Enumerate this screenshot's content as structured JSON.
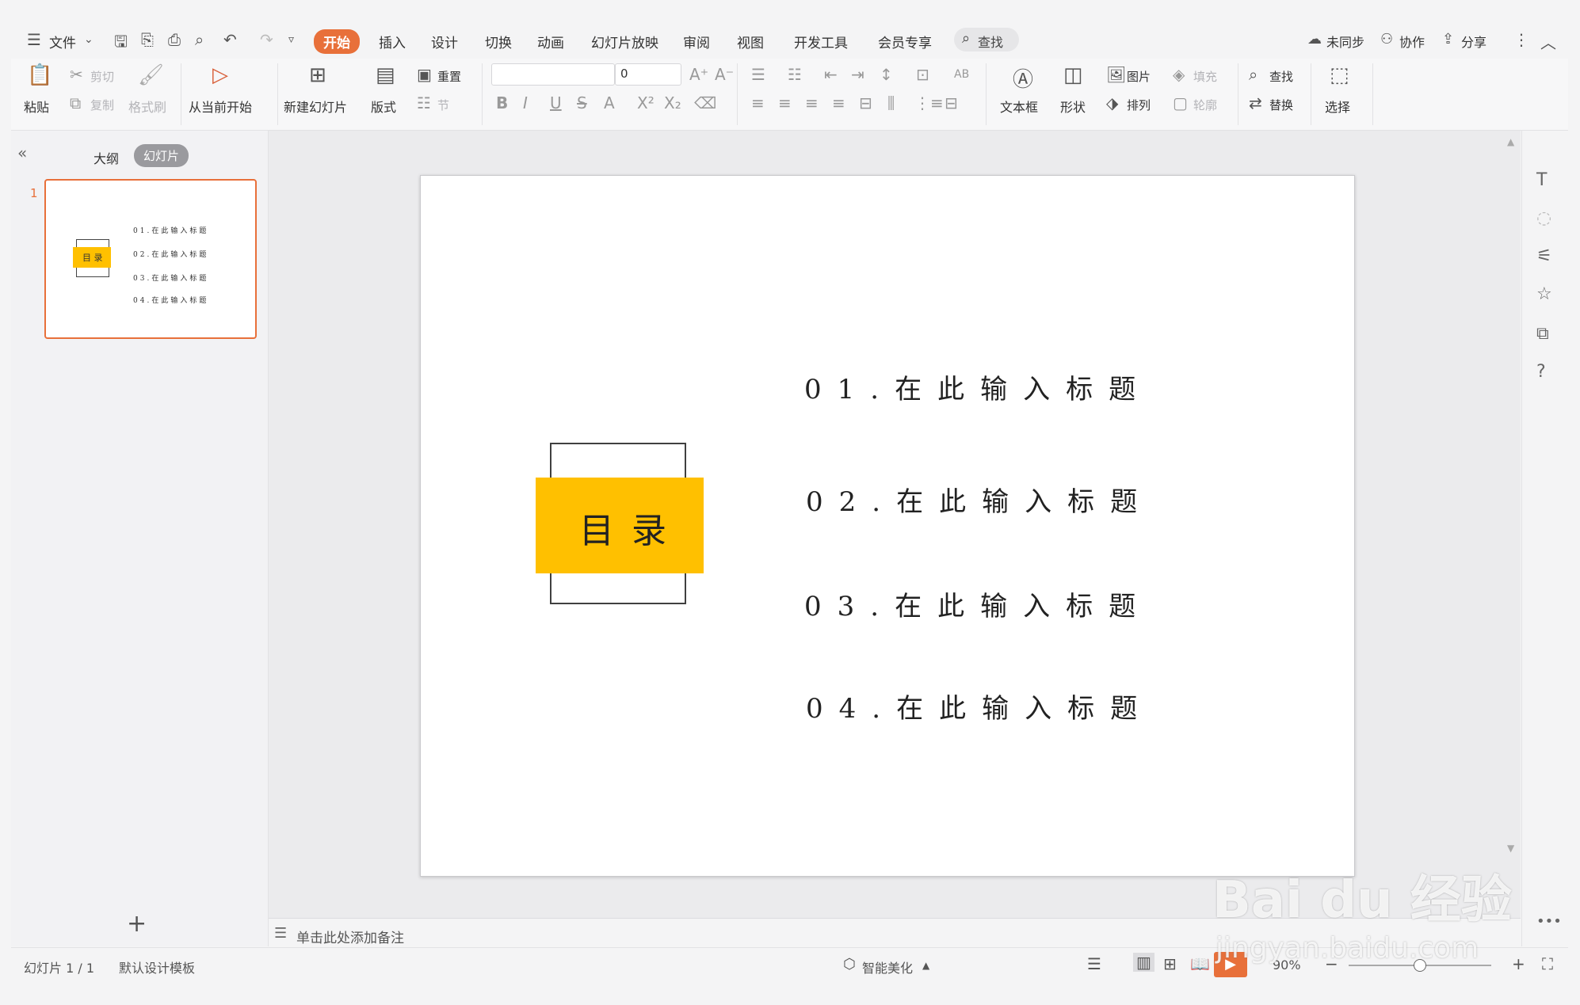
{
  "menubar": {
    "file": "文件",
    "tabs": [
      "开始",
      "插入",
      "设计",
      "切换",
      "动画",
      "幻灯片放映",
      "审阅",
      "视图",
      "开发工具",
      "会员专享"
    ],
    "search": "查找",
    "sync": "未同步",
    "collab": "协作",
    "share": "分享"
  },
  "ribbon": {
    "paste": "粘贴",
    "cut": "剪切",
    "copy": "复制",
    "format_painter": "格式刷",
    "play_from_current": "从当前开始",
    "new_slide": "新建幻灯片",
    "layout": "版式",
    "reset": "重置",
    "section": "节",
    "font_size": "0",
    "textbox": "文本框",
    "shape": "形状",
    "picture": "图片",
    "fill": "填充",
    "arrange": "排列",
    "outline": "轮廓",
    "find": "查找",
    "replace": "替换",
    "select": "选择"
  },
  "leftpanel": {
    "tab_outline": "大纲",
    "tab_slides": "幻灯片",
    "slide_number": "1",
    "add": "+"
  },
  "slide": {
    "title": "目 录",
    "items": [
      "01.在此输入标题",
      "02.在此输入标题",
      "03.在此输入标题",
      "04.在此输入标题"
    ],
    "accent_color": "#ffc000"
  },
  "notes_placeholder": "单击此处添加备注",
  "statusbar": {
    "slide_count": "幻灯片 1 / 1",
    "template": "默认设计模板",
    "beautify": "智能美化",
    "zoom": "90%"
  },
  "watermark": {
    "logo": "Bai du 经验",
    "url": "jingyan.baidu.com"
  }
}
